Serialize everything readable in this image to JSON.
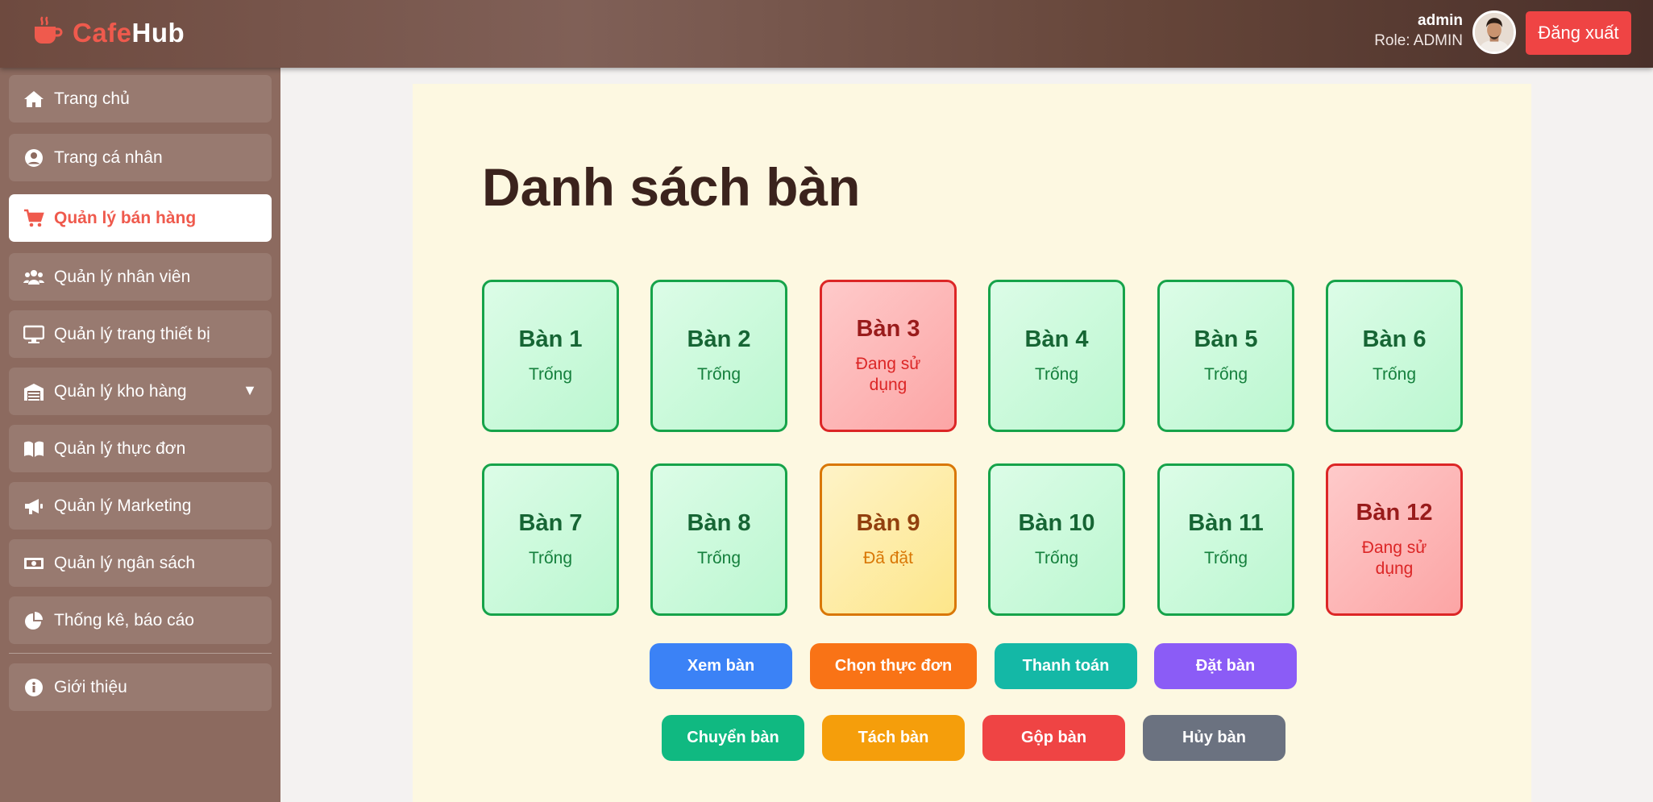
{
  "app": {
    "logo_part1": "Cafe",
    "logo_part2": "Hub"
  },
  "user": {
    "name": "admin",
    "role": "Role: ADMIN",
    "logout_label": "Đăng xuất"
  },
  "sidebar": {
    "items": [
      {
        "label": "Trang chủ",
        "icon": "home-icon"
      },
      {
        "label": "Trang cá nhân",
        "icon": "user-circle-icon"
      },
      {
        "label": "Quản lý bán hàng",
        "icon": "cart-icon",
        "active": true
      },
      {
        "label": "Quản lý nhân viên",
        "icon": "users-icon"
      },
      {
        "label": "Quản lý trang thiết bị",
        "icon": "monitor-icon"
      },
      {
        "label": "Quản lý kho hàng",
        "icon": "warehouse-icon",
        "has_caret": true,
        "caret": "▼"
      },
      {
        "label": "Quản lý thực đơn",
        "icon": "book-icon"
      },
      {
        "label": "Quản lý Marketing",
        "icon": "megaphone-icon"
      },
      {
        "label": "Quản lý ngân sách",
        "icon": "money-icon"
      },
      {
        "label": "Thống kê, báo cáo",
        "icon": "pie-chart-icon"
      },
      {
        "label": "Giới thiệu",
        "icon": "info-icon"
      }
    ]
  },
  "main": {
    "title": "Danh sách bàn",
    "tables": [
      {
        "name": "Bàn 1",
        "status": "Trống",
        "state": "free"
      },
      {
        "name": "Bàn 2",
        "status": "Trống",
        "state": "free"
      },
      {
        "name": "Bàn 3",
        "status": "Đang sử dụng",
        "state": "busy"
      },
      {
        "name": "Bàn 4",
        "status": "Trống",
        "state": "free"
      },
      {
        "name": "Bàn 5",
        "status": "Trống",
        "state": "free"
      },
      {
        "name": "Bàn 6",
        "status": "Trống",
        "state": "free"
      },
      {
        "name": "Bàn 7",
        "status": "Trống",
        "state": "free"
      },
      {
        "name": "Bàn 8",
        "status": "Trống",
        "state": "free"
      },
      {
        "name": "Bàn 9",
        "status": "Đã đặt",
        "state": "reserved"
      },
      {
        "name": "Bàn 10",
        "status": "Trống",
        "state": "free"
      },
      {
        "name": "Bàn 11",
        "status": "Trống",
        "state": "free"
      },
      {
        "name": "Bàn 12",
        "status": "Đang sử dụng",
        "state": "busy"
      }
    ],
    "actions_row1": [
      {
        "label": "Xem bàn",
        "color": "#3b82f6"
      },
      {
        "label": "Chọn thực đơn",
        "color": "#f97316"
      },
      {
        "label": "Thanh toán",
        "color": "#14b8a6"
      },
      {
        "label": "Đặt bàn",
        "color": "#8b5cf6"
      }
    ],
    "actions_row2": [
      {
        "label": "Chuyển bàn",
        "color": "#10b981"
      },
      {
        "label": "Tách bàn",
        "color": "#f59e0b"
      },
      {
        "label": "Gộp bàn",
        "color": "#ef4444"
      },
      {
        "label": "Hủy bàn",
        "color": "#6b7280"
      }
    ]
  },
  "colors": {
    "brand": "#ef5a4d",
    "header": "#6e4a3f",
    "sidebar": "#8c6a5f",
    "panel": "#fdf8e1"
  }
}
